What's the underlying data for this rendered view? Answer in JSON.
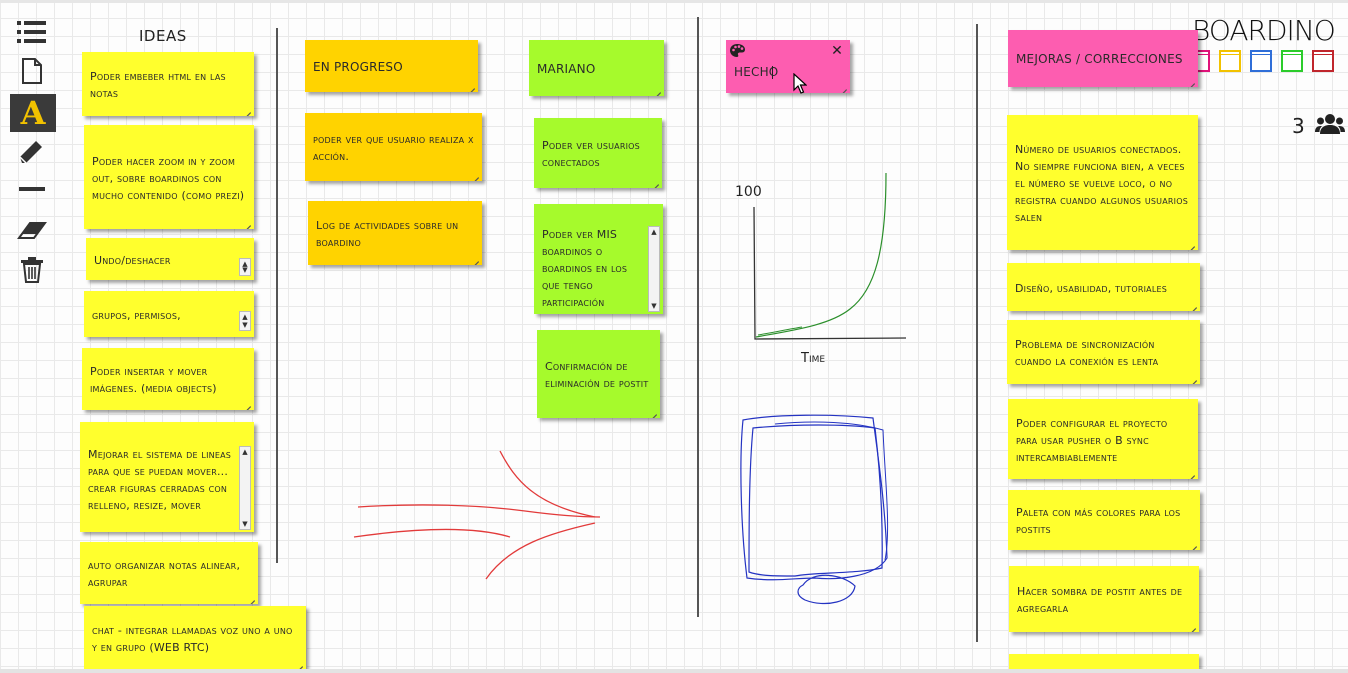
{
  "brand": {
    "name": "BOARDINO",
    "colors": [
      "#e0127a",
      "#f2c200",
      "#2f6ed8",
      "#2bcc2b",
      "#c0262c"
    ]
  },
  "toolbar": {
    "tools": [
      {
        "name": "menu-icon"
      },
      {
        "name": "new-note-icon"
      },
      {
        "name": "text-tool-icon",
        "label": "A",
        "active": true
      },
      {
        "name": "pencil-icon"
      },
      {
        "name": "line-tool-icon"
      },
      {
        "name": "eraser-icon"
      },
      {
        "name": "trash-icon"
      }
    ]
  },
  "users": {
    "count": "3",
    "icon": "users-icon"
  },
  "columns": {
    "ideas_title": "IDEAS"
  },
  "notes": {
    "ideas": [
      "Poder embeber html en las notas",
      "Poder hacer zoom in y zoom out, sobre boardinos con mucho contenido (como prezi)",
      "Undo/deshacer",
      "grupos, permisos,",
      "Poder insertar y mover imágenes. (media objects)",
      "Mejorar el sistema de lineas para que se puedan mover... crear figuras cerradas con relleno, resize, mover",
      "auto organizar notas alinear, agrupar",
      "chat - integrar llamadas voz  uno a uno y en grupo (WEB RTC)"
    ],
    "in_progress_title": "EN PROGRESO",
    "in_progress": [
      "poder ver que usuario realiza x acción.",
      "Log de actividades sobre un boardino"
    ],
    "mariano_title": "MARIANO",
    "mariano": [
      "Poder ver usuarios conectados",
      "Poder ver MIS boardinos o boardinos en los que tengo participación",
      "Confirmación de eliminación de postit"
    ],
    "done_title": "HECHO",
    "improvements_title": "MEJORAS / CORRECCIONES",
    "improvements": [
      "Número de usuarios conectados. No siempre funciona bien, a veces el número se vuelve loco, o no registra cuando algunos usuarios salen",
      "Diseño, usabilidad, tutoriales",
      "Problema de sincronización cuando la conexión es lenta",
      "Poder configurar el proyecto para usar pusher o B sync intercambiablemente",
      "Paleta con más colores para los postits",
      "Hacer sombra de postit antes de agregarla",
      ""
    ]
  },
  "sketch_chart": {
    "y_label": "100",
    "x_label": "Time"
  },
  "colors": {
    "yellow": "#ffff2d",
    "orange": "#ffd300",
    "green": "#a6fa2c",
    "pink": "#fd5db0"
  }
}
